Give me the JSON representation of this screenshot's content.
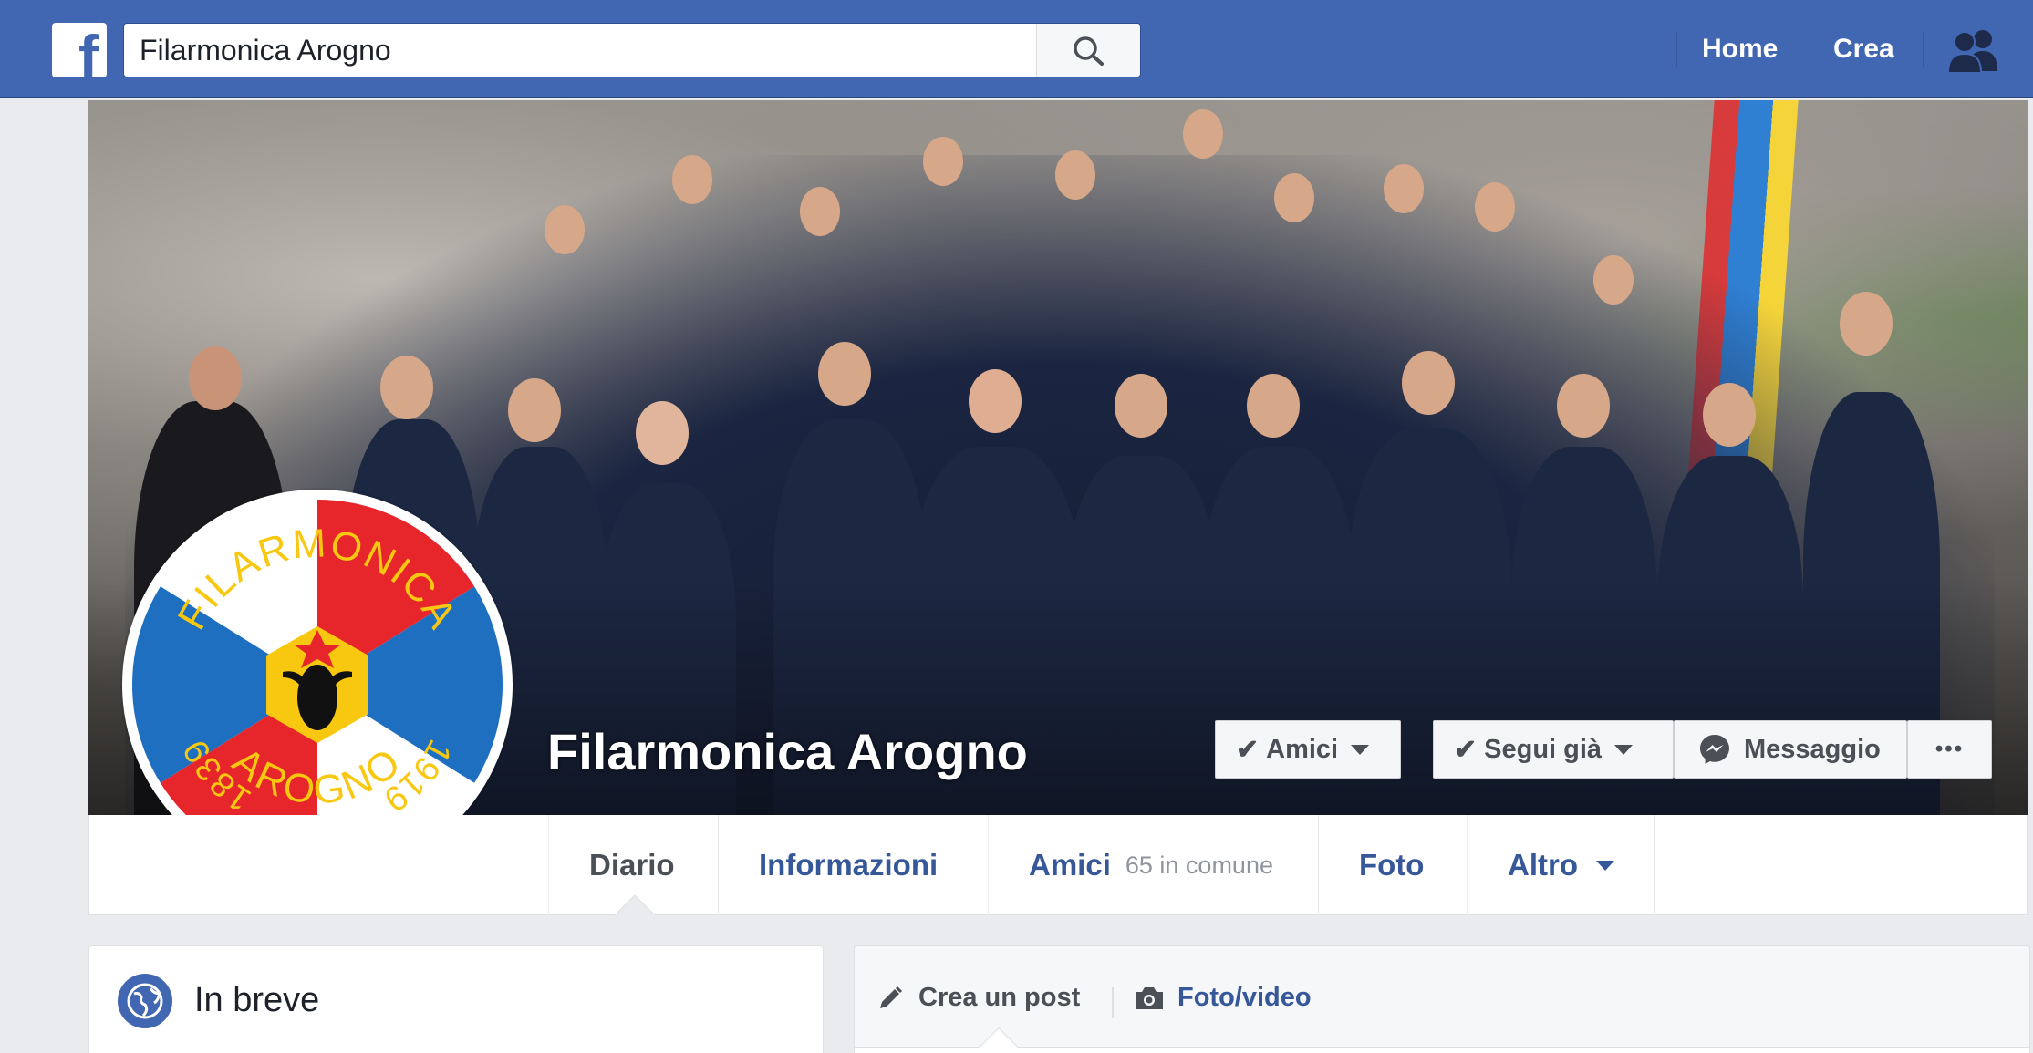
{
  "header": {
    "logo": "facebook-logo",
    "logo_letter": "f",
    "search_value": "Filarmonica Arogno",
    "nav": {
      "home": "Home",
      "create": "Crea"
    },
    "icons": {
      "search": "search-icon",
      "friends": "friends-icon"
    }
  },
  "cover": {
    "page_name": "Filarmonica Arogno",
    "logo_texts": {
      "top": "FILARMONICA",
      "bottom": "AROGNO",
      "year_left": "1839",
      "year_right": "1919"
    },
    "buttons": {
      "friends": "Amici",
      "follow": "Segui già",
      "message": "Messaggio",
      "more": "•••"
    }
  },
  "tabs": [
    {
      "label": "Diario"
    },
    {
      "label": "Informazioni"
    },
    {
      "label": "Amici",
      "sub": "65 in comune"
    },
    {
      "label": "Foto"
    },
    {
      "label": "Altro"
    }
  ],
  "about": {
    "title": "In breve"
  },
  "composer": {
    "create_post": "Crea un post",
    "photo_video": "Foto/video"
  },
  "colors": {
    "brand": "#4267b2",
    "link": "#365899",
    "background": "#e9ebee"
  }
}
